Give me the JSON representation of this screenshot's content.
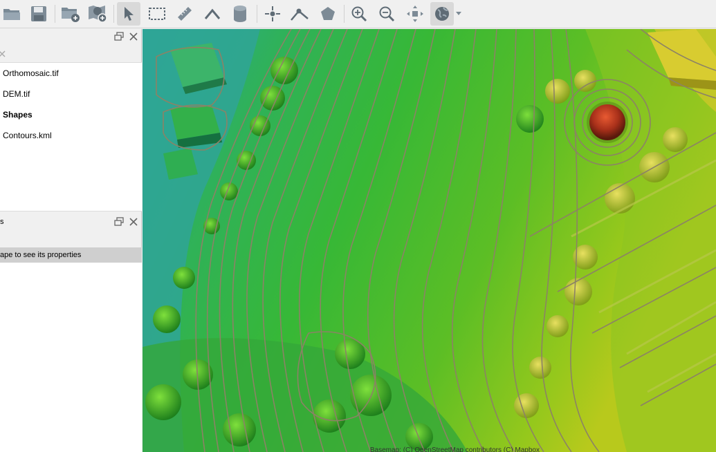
{
  "toolbar": {
    "tools": [
      {
        "name": "open-folder"
      },
      {
        "name": "save"
      },
      {
        "name": "add-layer"
      },
      {
        "name": "add-map-service"
      },
      {
        "name": "select"
      },
      {
        "name": "select-rectangle"
      },
      {
        "name": "measure-distance"
      },
      {
        "name": "draw-polyline"
      },
      {
        "name": "volume"
      },
      {
        "name": "add-point"
      },
      {
        "name": "add-line"
      },
      {
        "name": "add-polygon"
      },
      {
        "name": "zoom-in"
      },
      {
        "name": "zoom-out"
      },
      {
        "name": "zoom-extent"
      },
      {
        "name": "basemap"
      }
    ]
  },
  "layers_panel": {
    "items": [
      {
        "label": "Orthomosaic.tif",
        "bold": false
      },
      {
        "label": "DEM.tif",
        "bold": false
      },
      {
        "label": "Shapes",
        "bold": true
      },
      {
        "label": "Contours.kml",
        "bold": false
      }
    ]
  },
  "properties_panel": {
    "title_fragment": "s",
    "hint": "ape to see its properties"
  },
  "map": {
    "attribution": "Basemap: (C) OpenStreetMap contributors (C) Mapbox"
  },
  "colors": {
    "contour": "#8c8266",
    "dem_low": "#3aa6a0",
    "dem_mid": "#44b83a",
    "dem_high": "#c8c020",
    "dem_peak": "#a0301a"
  }
}
